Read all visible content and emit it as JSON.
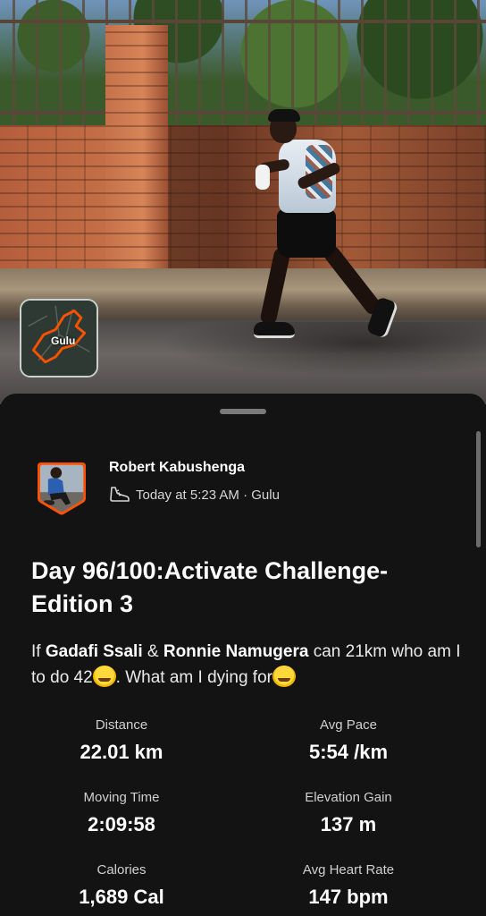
{
  "photo": {
    "map": {
      "place_label": "Gulu",
      "route_color": "#fc5200"
    }
  },
  "activity": {
    "athlete_name": "Robert Kabushenga",
    "meta_text": "Today at 5:23 AM · Gulu",
    "meta_icon": "running-shoe-icon",
    "title": "Day 96/100:Activate Challenge-Edition 3",
    "description": {
      "prefix": "If ",
      "name1": "Gadafi Ssali",
      "mid1": " & ",
      "name2": "Ronnie Namugera",
      "mid2": " can 21km who am I to do 42",
      "emoji1": "thinking-face-icon",
      "mid3": ".  What am I dying for",
      "emoji2": "rolling-laughing-face-icon"
    },
    "stats": [
      {
        "label": "Distance",
        "value": "22.01 km"
      },
      {
        "label": "Avg Pace",
        "value": "5:54 /km"
      },
      {
        "label": "Moving Time",
        "value": "2:09:58"
      },
      {
        "label": "Elevation Gain",
        "value": "137 m"
      },
      {
        "label": "Calories",
        "value": "1,689 Cal"
      },
      {
        "label": "Avg Heart Rate",
        "value": "147 bpm"
      }
    ]
  },
  "colors": {
    "background": "#131313",
    "accent": "#fc5200",
    "text": "#ffffff"
  }
}
